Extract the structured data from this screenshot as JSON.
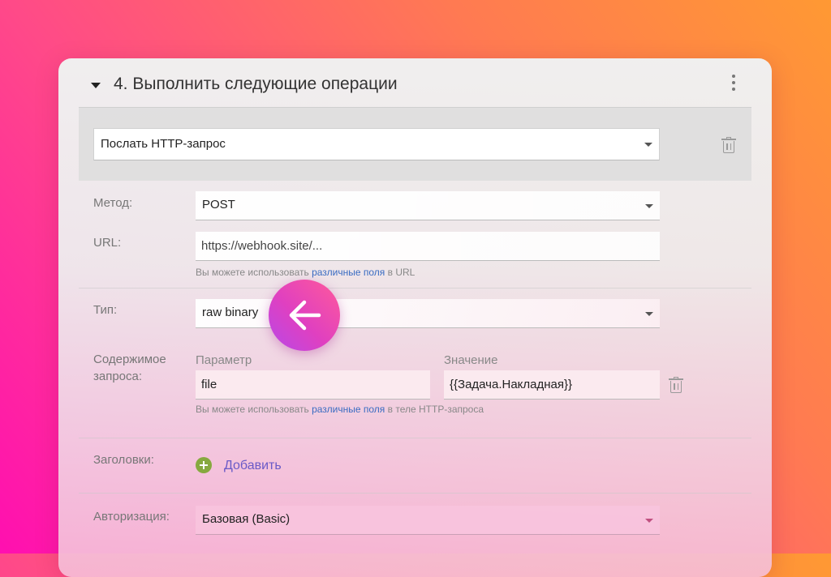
{
  "step": {
    "title": "4. Выполнить следующие операции"
  },
  "action": {
    "selected": "Послать HTTP-запрос"
  },
  "method": {
    "label": "Метод:",
    "value": "POST"
  },
  "url": {
    "label": "URL:",
    "value": "https://webhook.site/...",
    "hint_prefix": "Вы можете использовать",
    "hint_link": "различные поля",
    "hint_suffix": "в URL"
  },
  "type": {
    "label": "Тип:",
    "value": "raw binary"
  },
  "body": {
    "label": "Содержимое запроса:",
    "param_header": "Параметр",
    "value_header": "Значение",
    "param_value": "file",
    "value_value": "{{Задача.Накладная}}",
    "hint_prefix": "Вы можете использовать",
    "hint_link": "различные поля",
    "hint_suffix": "в теле HTTP-запроса"
  },
  "headers": {
    "label": "Заголовки:",
    "add_label": "Добавить"
  },
  "auth": {
    "label": "Авторизация:",
    "value": "Базовая (Basic)"
  },
  "icons": {
    "collapse": "caret-down-icon",
    "menu": "kebab-menu-icon",
    "delete": "trash-icon",
    "add": "plus-circle-icon",
    "back": "arrow-left-icon"
  },
  "colors": {
    "link": "#3a6cc2",
    "add_link": "#6a5ac7",
    "add_icon": "#86a93f",
    "accent_start": "#ff5a9a",
    "accent_end": "#b848e8"
  }
}
